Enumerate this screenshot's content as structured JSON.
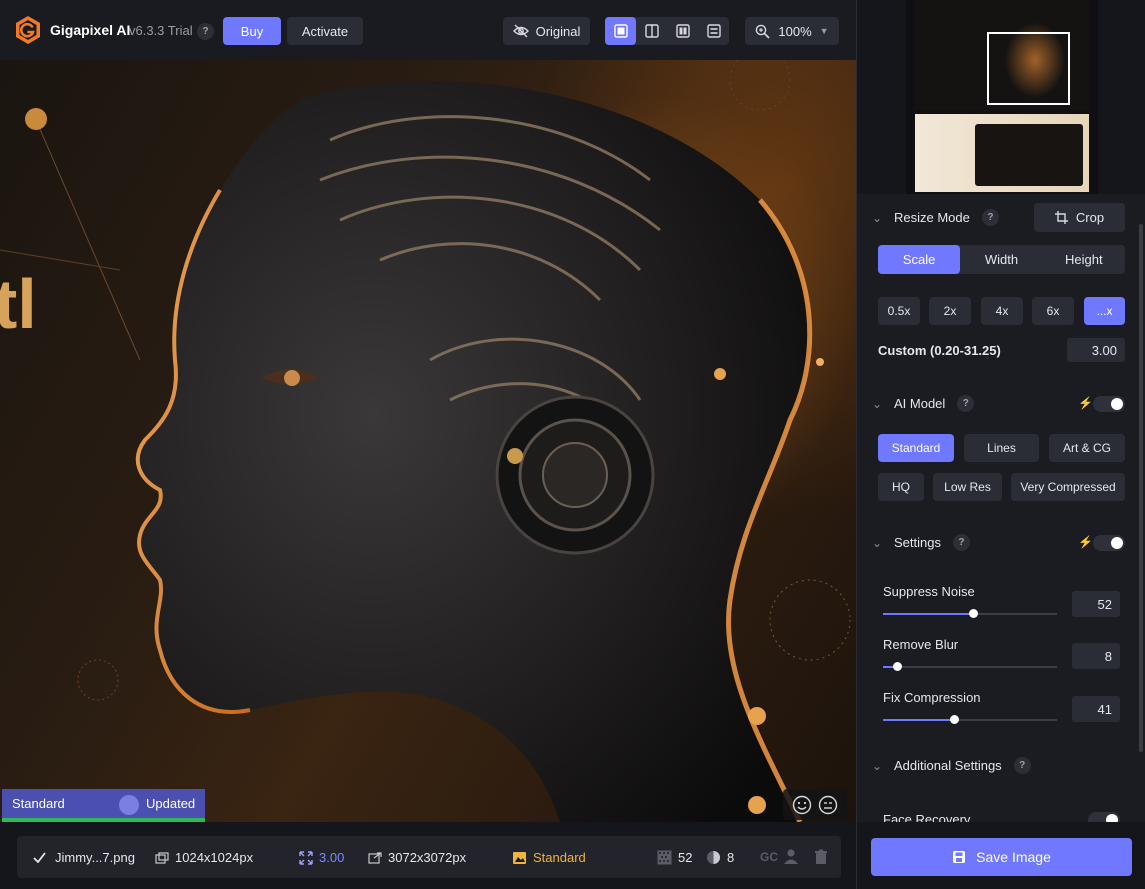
{
  "topbar": {
    "app_name": "Gigapixel AI",
    "version": "v6.3.3 Trial",
    "help": "?",
    "buy_label": "Buy",
    "activate_label": "Activate",
    "original_label": "Original",
    "zoom": "100%",
    "view_modes": [
      "single-view",
      "split-view",
      "side-by-side-view",
      "quad-view"
    ],
    "active_view": "single-view"
  },
  "canvas": {
    "overlay_left": "Standard",
    "overlay_right": "Updated",
    "image_text": "tl"
  },
  "info_bar": {
    "filename": "Jimmy...7.png",
    "input_size": "1024x1024px",
    "scale": "3.00",
    "output_size": "3072x3072px",
    "model": "Standard",
    "noise_value": "52",
    "blur_value": "8",
    "gc": "GC"
  },
  "panel": {
    "resize_mode": {
      "title": "Resize Mode",
      "help": "?",
      "crop_label": "Crop",
      "tabs": [
        "Scale",
        "Width",
        "Height"
      ],
      "active_tab": "Scale",
      "presets": [
        "0.5x",
        "2x",
        "4x",
        "6x",
        "...x"
      ],
      "active_preset": "...x",
      "custom_label": "Custom (0.20-31.25)",
      "custom_value": "3.00"
    },
    "ai_model": {
      "title": "AI Model",
      "help": "?",
      "row1": [
        "Standard",
        "Lines",
        "Art & CG"
      ],
      "row2": [
        "HQ",
        "Low Res",
        "Very Compressed"
      ],
      "active": "Standard"
    },
    "settings": {
      "title": "Settings",
      "help": "?",
      "suppress_noise": {
        "label": "Suppress Noise",
        "value": "52",
        "fraction": 0.52
      },
      "remove_blur": {
        "label": "Remove Blur",
        "value": "8",
        "fraction": 0.08
      },
      "fix_compression": {
        "label": "Fix Compression",
        "value": "41",
        "fraction": 0.41
      }
    },
    "additional": {
      "title": "Additional Settings",
      "help": "?",
      "face_recovery": "Face Recovery"
    },
    "save_label": "Save Image"
  },
  "colors": {
    "accent": "#6f78ff",
    "gold": "#f0b43a",
    "green": "#2fb85a"
  }
}
